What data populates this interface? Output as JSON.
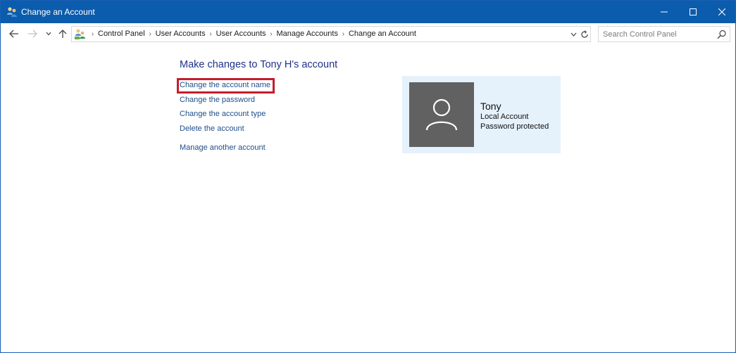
{
  "window": {
    "title": "Change an Account",
    "controls": {
      "minimize_icon": "minimize-icon",
      "maximize_icon": "maximize-icon",
      "close_icon": "close-icon"
    }
  },
  "address_bar": {
    "breadcrumbs": [
      "Control Panel",
      "User Accounts",
      "User Accounts",
      "Manage Accounts",
      "Change an Account"
    ],
    "separator": "›"
  },
  "search": {
    "placeholder": "Search Control Panel",
    "value": ""
  },
  "main": {
    "heading": "Make changes to Tony H's account",
    "tasks": [
      "Change the account name",
      "Change the password",
      "Change the account type",
      "Delete the account"
    ],
    "manage_another": "Manage another account"
  },
  "account": {
    "name": "Tony",
    "type": "Local Account",
    "status": "Password protected"
  },
  "colors": {
    "titlebar": "#0b5cad",
    "link": "#1e4e8c",
    "heading": "#1e3287",
    "highlight": "#c41d2b",
    "panel": "#e5f1fb",
    "avatar": "#616161"
  }
}
